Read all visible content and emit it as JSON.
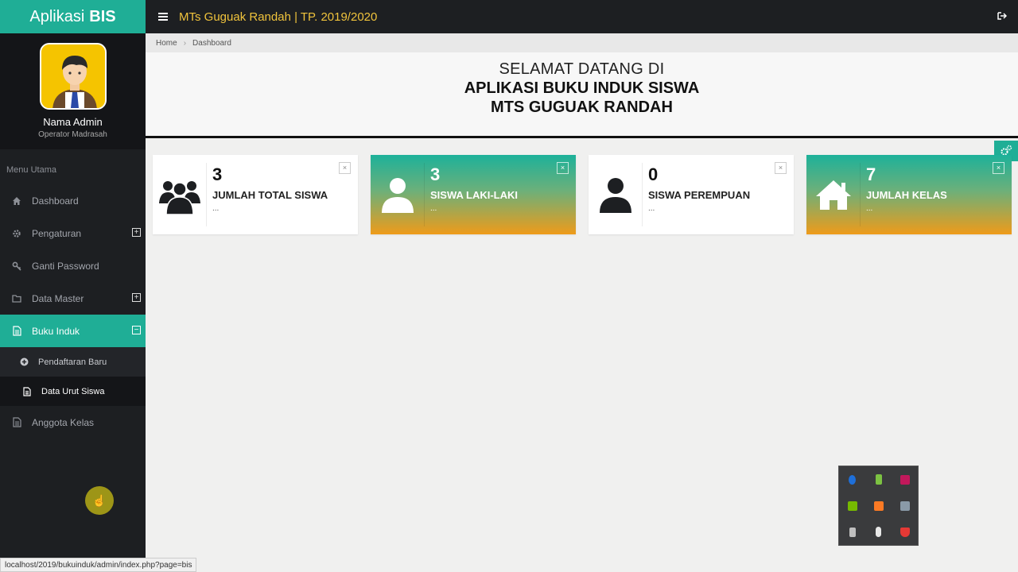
{
  "brand": {
    "prefix": "Aplikasi",
    "bold": "BIS"
  },
  "profile": {
    "name": "Nama Admin",
    "role": "Operator Madrasah"
  },
  "menu": {
    "header": "Menu Utama",
    "items": [
      {
        "label": "Dashboard",
        "icon": "home-icon"
      },
      {
        "label": "Pengaturan",
        "icon": "gear-icon",
        "expand": "+"
      },
      {
        "label": "Ganti Password",
        "icon": "key-icon"
      },
      {
        "label": "Data Master",
        "icon": "folder-icon",
        "expand": "+"
      },
      {
        "label": "Buku Induk",
        "icon": "document-icon",
        "expand": "−",
        "active": true
      },
      {
        "label": "Anggota Kelas",
        "icon": "document-icon"
      }
    ],
    "submenu": [
      {
        "label": "Pendaftaran Baru",
        "icon": "plus-circle-icon"
      },
      {
        "label": "Data Urut Siswa",
        "icon": "document-icon",
        "current": true
      }
    ]
  },
  "topbar": {
    "title": "MTs Guguak Randah | TP. 2019/2020"
  },
  "breadcrumb": {
    "home": "Home",
    "sep": "›",
    "current": "Dashboard"
  },
  "welcome": {
    "line1": "SELAMAT DATANG DI",
    "line2": "APLIKASI BUKU INDUK SISWA",
    "line3": "MTS GUGUAK RANDAH"
  },
  "cards": [
    {
      "value": "3",
      "label": "JUMLAH TOTAL SISWA",
      "more": "...",
      "icon": "users-icon"
    },
    {
      "value": "3",
      "label": "SISWA LAKI-LAKI",
      "more": "...",
      "icon": "user-icon"
    },
    {
      "value": "0",
      "label": "SISWA PEREMPUAN",
      "more": "...",
      "icon": "user-icon"
    },
    {
      "value": "7",
      "label": "JUMLAH KELAS",
      "more": "...",
      "icon": "house-icon"
    }
  ],
  "close_glyph": "×",
  "status_url": "localhost/2019/bukuinduk/admin/index.php?page=bis",
  "colors": {
    "accent": "#1fae96",
    "title": "#f0c33c",
    "gradient_end": "#ef9b1a"
  }
}
